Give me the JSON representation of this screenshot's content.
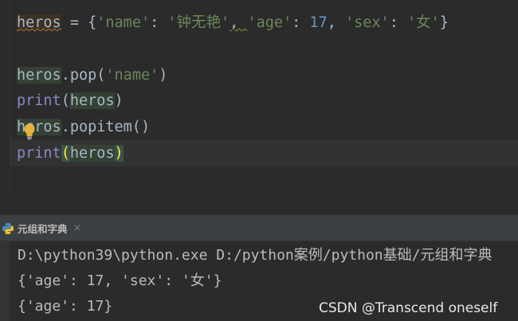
{
  "editor": {
    "line1": {
      "var": "heros",
      "assign": " = ",
      "lbrace": "{",
      "k1": "'name'",
      "c1": ": ",
      "v1": "'钟无艳'",
      "sep1": ", ",
      "k2": "'age'",
      "c2": ": ",
      "v2": "17",
      "sep2": ", ",
      "k3": "'sex'",
      "c3": ": ",
      "v3": "'女'",
      "rbrace": "}"
    },
    "line3": {
      "var": "heros",
      "call": ".pop(",
      "arg": "'name'",
      "close": ")"
    },
    "line4": {
      "fn": "print",
      "open": "(",
      "arg": "heros",
      "close": ")"
    },
    "line5": {
      "var": "heros",
      "call": ".popitem()"
    },
    "line6": {
      "fn": "print",
      "open": "(",
      "arg": "heros",
      "close": ")"
    }
  },
  "run": {
    "tab_label": "元组和字典",
    "close_glyph": "×",
    "output": [
      "D:\\python39\\python.exe D:/python案例/python基础/元组和字典",
      "{'age': 17, 'sex': '女'}",
      "{'age': 17}"
    ]
  },
  "watermark": "CSDN @Transcend oneself"
}
